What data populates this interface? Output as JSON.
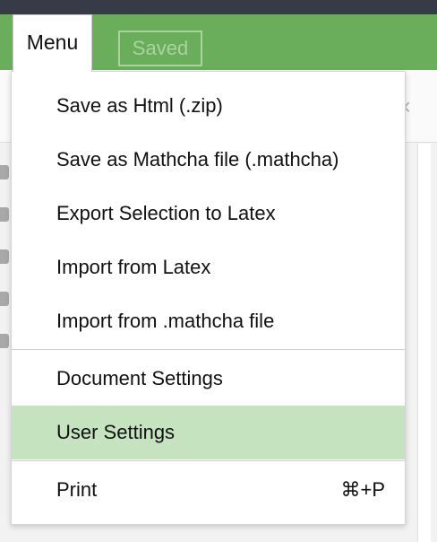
{
  "toolbar": {
    "menu_label": "Menu",
    "saved_label": "Saved"
  },
  "menu": {
    "items": [
      {
        "label": "Save as Html (.zip)"
      },
      {
        "label": "Save as Mathcha file (.mathcha)"
      },
      {
        "label": "Export Selection to Latex"
      },
      {
        "label": "Import from Latex"
      },
      {
        "label": "Import from .mathcha file"
      },
      {
        "label": "Document Settings"
      },
      {
        "label": "User Settings",
        "highlighted": true
      },
      {
        "label": "Print",
        "shortcut": "⌘+P"
      }
    ]
  },
  "document": {
    "close_glyph": "×"
  },
  "colors": {
    "toolbar": "#6aae5c",
    "top_strip": "#363b47",
    "highlight": "#c6e3c0"
  }
}
